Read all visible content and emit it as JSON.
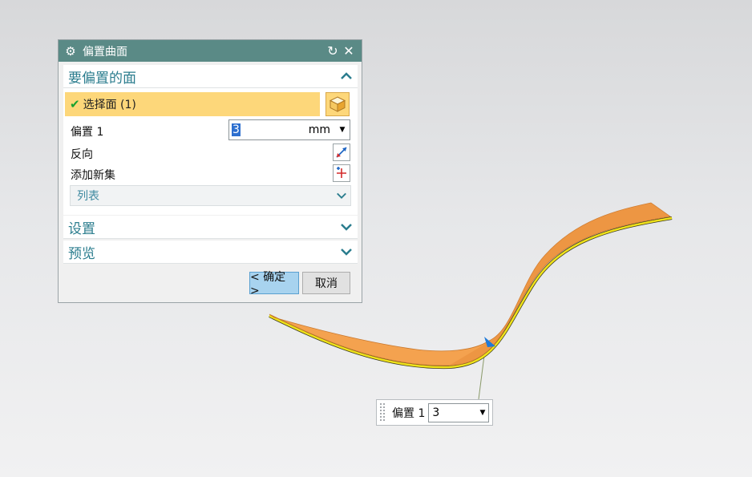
{
  "dialog": {
    "title": "偏置曲面",
    "sections": {
      "faces": {
        "label": "要偏置的面",
        "expanded": true
      },
      "settings": {
        "label": "设置",
        "expanded": false
      },
      "preview": {
        "label": "预览",
        "expanded": false
      }
    },
    "select_face": {
      "check": "✔",
      "label": "选择面 (1)"
    },
    "offset": {
      "label": "偏置 1",
      "value": "3",
      "unit": "mm"
    },
    "reverse_label": "反向",
    "add_set_label": "添加新集",
    "list_label": "列表",
    "ok_label": "< 确定 >",
    "cancel_label": "取消"
  },
  "float_input": {
    "label": "偏置 1",
    "value": "3"
  },
  "colors": {
    "titlebar": "#5a8a86",
    "section_text": "#2b7d8e",
    "selection_highlight": "#fdd77a",
    "surface": "#f4a24f",
    "surface_edge": "#f0e21a",
    "ok_button": "#a8d3ef"
  },
  "icons": {
    "gear": "gear-icon",
    "reset": "reset-icon",
    "close": "close-icon",
    "cube": "cube-icon",
    "reverse": "reverse-direction-icon",
    "add_set": "add-new-set-icon",
    "chevron_up": "chevron-up-icon",
    "chevron_down": "chevron-down-icon"
  }
}
